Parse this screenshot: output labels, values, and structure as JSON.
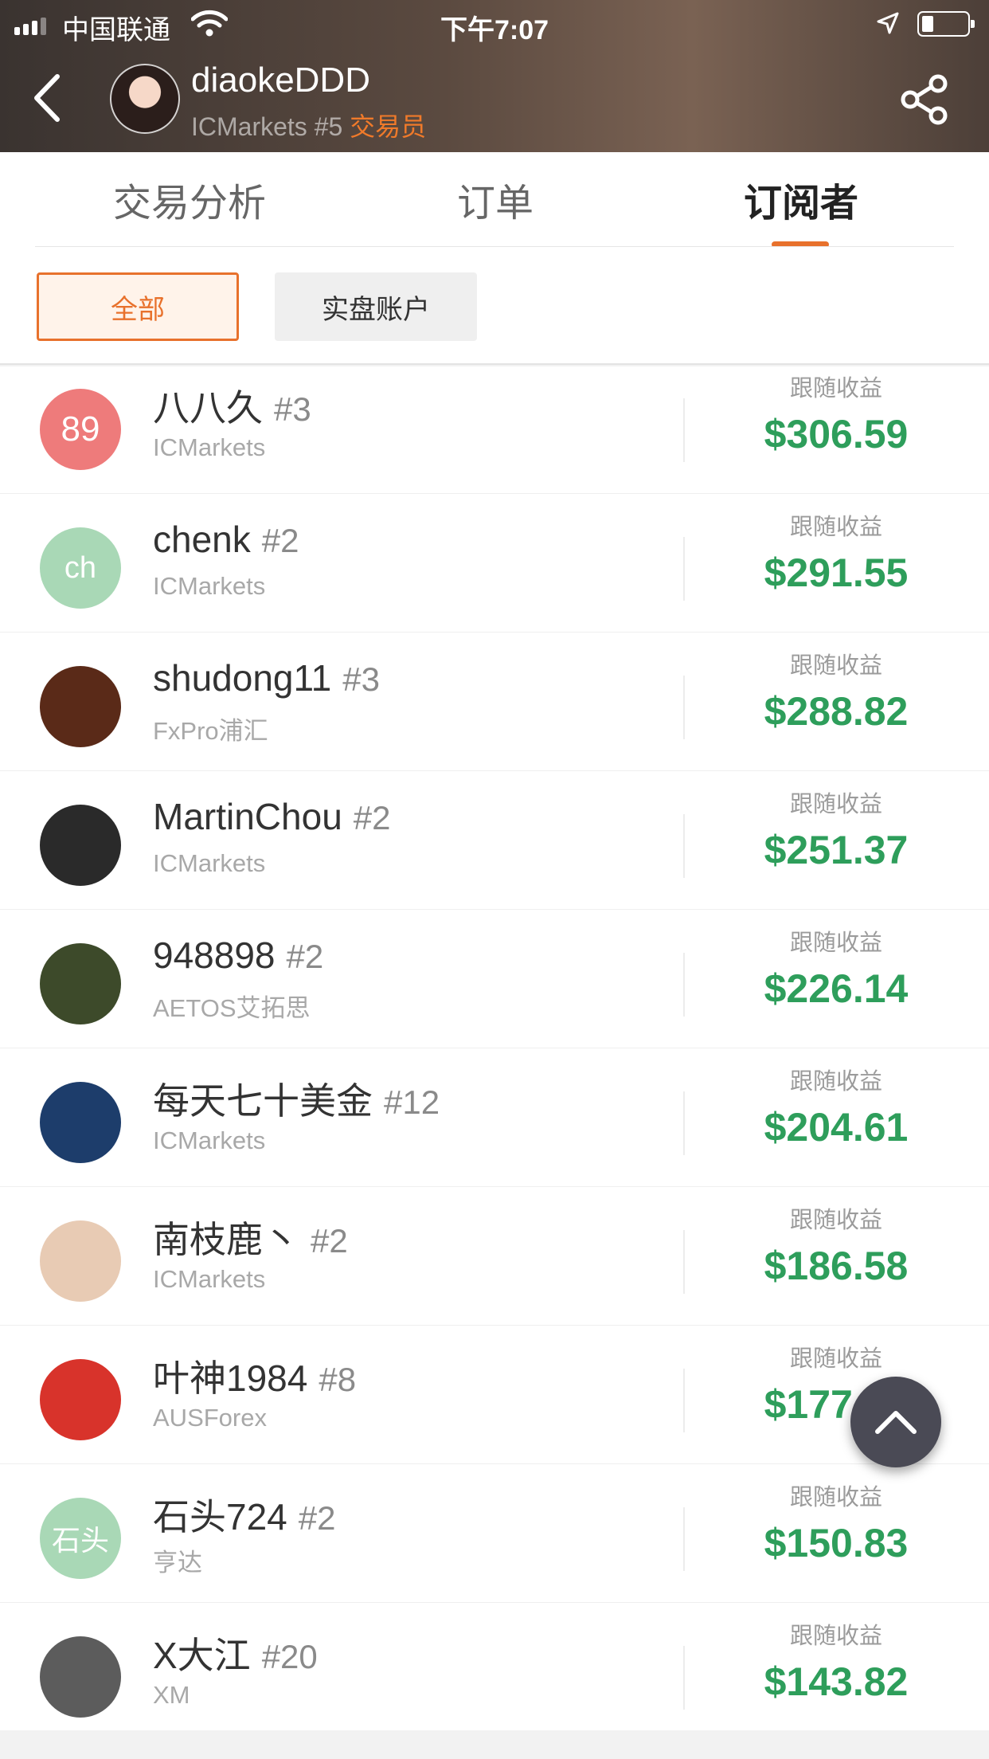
{
  "status_bar": {
    "carrier": "中国联通",
    "time": "下午7:07"
  },
  "trader": {
    "name": "diaokeDDD",
    "broker_rank": "ICMarkets #5",
    "role": "交易员"
  },
  "tabs": [
    {
      "label": "交易分析"
    },
    {
      "label": "订单"
    },
    {
      "label": "订阅者"
    }
  ],
  "active_tab": "订阅者",
  "filters": {
    "all": "全部",
    "live": "实盘账户"
  },
  "profit_label": "跟随收益",
  "subscribers": [
    {
      "name": "八八久",
      "rank": "#3",
      "broker": "ICMarkets",
      "profit": "$306.59",
      "avatar_text": "89",
      "avatar_color": "#ee7b7b"
    },
    {
      "name": "chenk",
      "rank": "#2",
      "broker": "ICMarkets",
      "profit": "$291.55",
      "avatar_text": "ch",
      "avatar_color": "#a9d8b6"
    },
    {
      "name": "shudong11",
      "rank": "#3",
      "broker": "FxPro浦汇",
      "profit": "$288.82",
      "avatar_text": "",
      "avatar_color": "#5a2a18"
    },
    {
      "name": "MartinChou",
      "rank": "#2",
      "broker": "ICMarkets",
      "profit": "$251.37",
      "avatar_text": "",
      "avatar_color": "#2a2a2a"
    },
    {
      "name": "948898",
      "rank": "#2",
      "broker": "AETOS艾拓思",
      "profit": "$226.14",
      "avatar_text": "",
      "avatar_color": "#3d4a2a"
    },
    {
      "name": "每天七十美金",
      "rank": "#12",
      "broker": "ICMarkets",
      "profit": "$204.61",
      "avatar_text": "",
      "avatar_color": "#1d3d6b"
    },
    {
      "name": "南枝鹿丶",
      "rank": "#2",
      "broker": "ICMarkets",
      "profit": "$186.58",
      "avatar_text": "",
      "avatar_color": "#e8cbb4"
    },
    {
      "name": "叶神1984",
      "rank": "#8",
      "broker": "AUSForex",
      "profit": "$177.65",
      "avatar_text": "",
      "avatar_color": "#d8332b"
    },
    {
      "name": "石头724",
      "rank": "#2",
      "broker": "亨达",
      "profit": "$150.83",
      "avatar_text": "石头",
      "avatar_color": "#a9d8b6"
    },
    {
      "name": "X大江",
      "rank": "#20",
      "broker": "XM",
      "profit": "$143.82",
      "avatar_text": "",
      "avatar_color": "#5c5c5c"
    }
  ],
  "colors": {
    "accent": "#e8712c",
    "profit": "#2e9e5b"
  }
}
